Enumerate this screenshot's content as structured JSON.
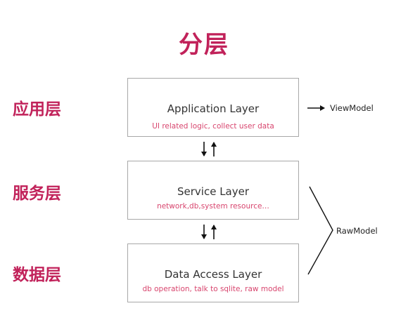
{
  "title": "分层",
  "layers": [
    {
      "side_label": "应用层",
      "name": "Application Layer",
      "description": "UI related logic, collect user data"
    },
    {
      "side_label": "服务层",
      "name": "Service Layer",
      "description": "network,db,system resource…"
    },
    {
      "side_label": "数据层",
      "name": "Data Access Layer",
      "description": "db operation, talk to sqlite, raw model"
    }
  ],
  "outputs": {
    "view_model": "ViewModel",
    "raw_model": "RawModel"
  },
  "colors": {
    "accent": "#c1225a",
    "description": "#d8456e",
    "box_border": "#a8a8a8",
    "text": "#333333"
  }
}
